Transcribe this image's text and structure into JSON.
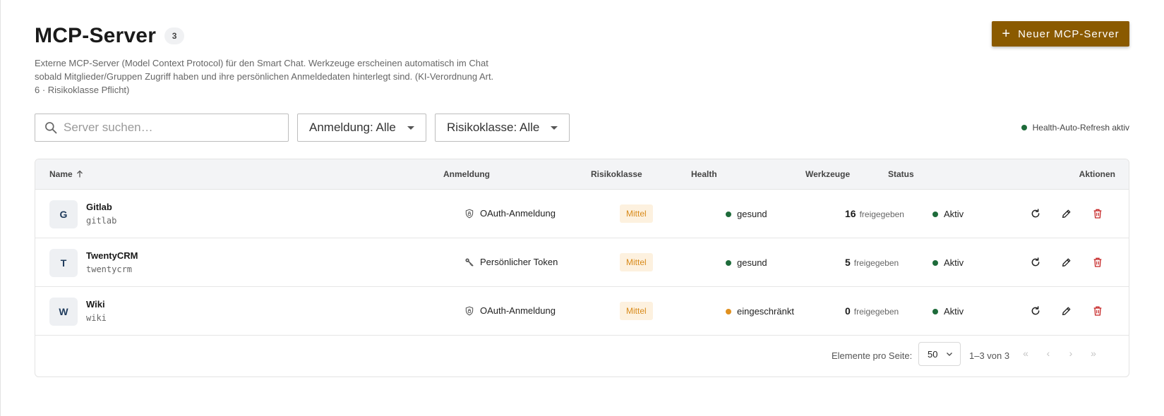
{
  "header": {
    "title": "MCP-Server",
    "count": "3",
    "description": "Externe MCP-Server (Model Context Protocol) für den Smart Chat. Werkzeuge erscheinen automatisch im Chat sobald Mitglieder/Gruppen Zugriff haben und ihre persönlichen Anmeldedaten hinterlegt sind. (KI-Verordnung Art. 6 · Risikoklasse Pflicht)",
    "new_button_label": "Neuer MCP-Server"
  },
  "filters": {
    "search_placeholder": "Server suchen…",
    "search_value": "",
    "login_select": "Anmeldung: Alle",
    "risk_select": "Risikoklasse: Alle",
    "refresh_status": "Health-Auto-Refresh aktiv"
  },
  "table": {
    "columns": {
      "name": "Name",
      "login": "Anmeldung",
      "risk": "Risikoklasse",
      "health": "Health",
      "tools": "Werkzeuge",
      "status": "Status",
      "actions": "Aktionen"
    },
    "rows": [
      {
        "initial": "G",
        "name": "Gitlab",
        "slug": "gitlab",
        "login": "OAuth-Anmeldung",
        "login_icon": "shield-lock-icon",
        "risk": "Mittel",
        "health": "gesund",
        "health_color": "#1e6b3a",
        "tools_count": "16",
        "tools_label": "freigegeben",
        "status": "Aktiv"
      },
      {
        "initial": "T",
        "name": "TwentyCRM",
        "slug": "twentycrm",
        "login": "Persönlicher Token",
        "login_icon": "key-icon",
        "risk": "Mittel",
        "health": "gesund",
        "health_color": "#1e6b3a",
        "tools_count": "5",
        "tools_label": "freigegeben",
        "status": "Aktiv"
      },
      {
        "initial": "W",
        "name": "Wiki",
        "slug": "wiki",
        "login": "OAuth-Anmeldung",
        "login_icon": "shield-lock-icon",
        "risk": "Mittel",
        "health": "eingeschränkt",
        "health_color": "#e0901f",
        "tools_count": "0",
        "tools_label": "freigegeben",
        "status": "Aktiv"
      }
    ]
  },
  "pagination": {
    "items_per_page_label": "Elemente pro Seite:",
    "page_size": "50",
    "range": "1–3 von 3",
    "first": "«",
    "prev": "‹",
    "next": "›",
    "last": "»"
  },
  "colors": {
    "accent": "#8a5a00",
    "healthy": "#1e6b3a",
    "degraded": "#e0901f",
    "risk_badge_bg": "#fdf1df",
    "risk_badge_text": "#d88a1a",
    "delete": "#c62828"
  }
}
